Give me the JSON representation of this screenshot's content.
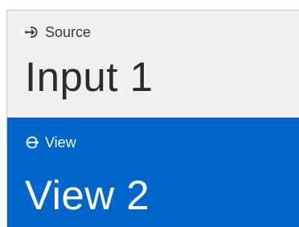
{
  "source": {
    "icon": "source-input-icon",
    "label": "Source",
    "value": "Input 1"
  },
  "view": {
    "icon": "view-output-icon",
    "label": "View",
    "value": "View 2"
  },
  "colors": {
    "source_bg": "#f0f0f0",
    "view_bg": "#0066cc"
  }
}
